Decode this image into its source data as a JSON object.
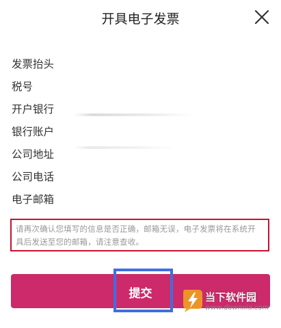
{
  "header": {
    "title": "开具电子发票",
    "close_icon": "close-icon"
  },
  "form": {
    "fields": [
      {
        "label": "发票抬头",
        "value": "",
        "placeholder": ""
      },
      {
        "label": "税号",
        "value": "",
        "placeholder": ""
      },
      {
        "label": "开户银行",
        "value": "",
        "placeholder": ""
      },
      {
        "label": "银行账户",
        "value": "",
        "placeholder": ""
      },
      {
        "label": "公司地址",
        "value": "",
        "placeholder": ""
      },
      {
        "label": "公司电话",
        "value": "",
        "placeholder": ""
      },
      {
        "label": "电子邮箱",
        "value": "",
        "placeholder": ""
      }
    ]
  },
  "notice": {
    "text": "请再次确认您填写的信息是否正确，邮箱无误，电子发票将在系统开具后发送至您的邮箱，请注意查收。"
  },
  "submit": {
    "label": "提交"
  },
  "watermark": {
    "text": "当下软件园",
    "url": "www.downxia.com"
  },
  "colors": {
    "accent": "#cc2a6a",
    "notice_border": "#c8102e",
    "highlight": "#3d6fe0",
    "notice_text": "#999999"
  }
}
